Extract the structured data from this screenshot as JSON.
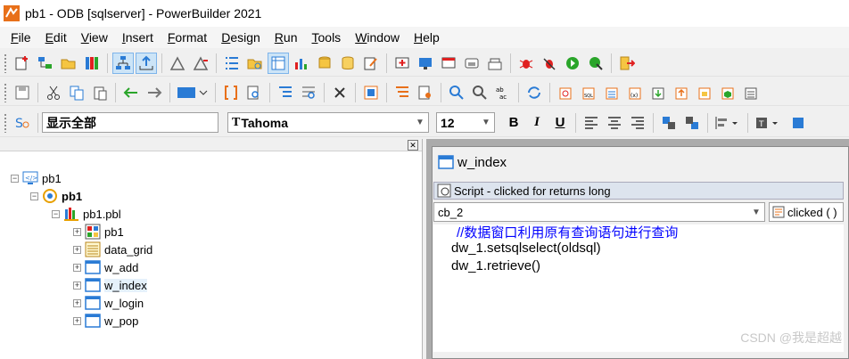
{
  "window": {
    "title": "pb1 - ODB [sqlserver]  - PowerBuilder 2021"
  },
  "menu": [
    {
      "label": "File",
      "key": "F",
      "rest": "ile"
    },
    {
      "label": "Edit",
      "key": "E",
      "rest": "dit"
    },
    {
      "label": "View",
      "key": "V",
      "rest": "iew"
    },
    {
      "label": "Insert",
      "key": "I",
      "rest": "nsert"
    },
    {
      "label": "Format",
      "key": "F",
      "rest": "ormat"
    },
    {
      "label": "Design",
      "key": "D",
      "rest": "esign"
    },
    {
      "label": "Run",
      "key": "R",
      "rest": "un"
    },
    {
      "label": "Tools",
      "key": "T",
      "rest": "ools"
    },
    {
      "label": "Window",
      "key": "W",
      "rest": "indow"
    },
    {
      "label": "Help",
      "key": "H",
      "rest": "elp"
    }
  ],
  "format_bar": {
    "style_value": "显示全部",
    "font_value": "Tahoma",
    "font_prefix": "T",
    "size_value": "12",
    "bold_label": "B",
    "italic_label": "I",
    "underline_label": "U"
  },
  "tree": {
    "workspace": "pb1",
    "target": "pb1",
    "library": "pb1.pbl",
    "objects": [
      "pb1",
      "data_grid",
      "w_add",
      "w_index",
      "w_login",
      "w_pop"
    ],
    "selected": "w_index"
  },
  "editor": {
    "window_title": "w_index",
    "script_title": "Script - clicked for  returns long",
    "object_select": "cb_2",
    "event_select": "clicked ( )",
    "code_lines": [
      "//数据窗口利用原有查询语句进行查询",
      "dw_1.setsqlselect(oldsql)",
      "dw_1.retrieve()"
    ]
  },
  "watermark": "CSDN @我是超越",
  "colors": {
    "comment": "#0000ff",
    "selection": "#e5f1fb",
    "mdi_background": "#ababab"
  }
}
